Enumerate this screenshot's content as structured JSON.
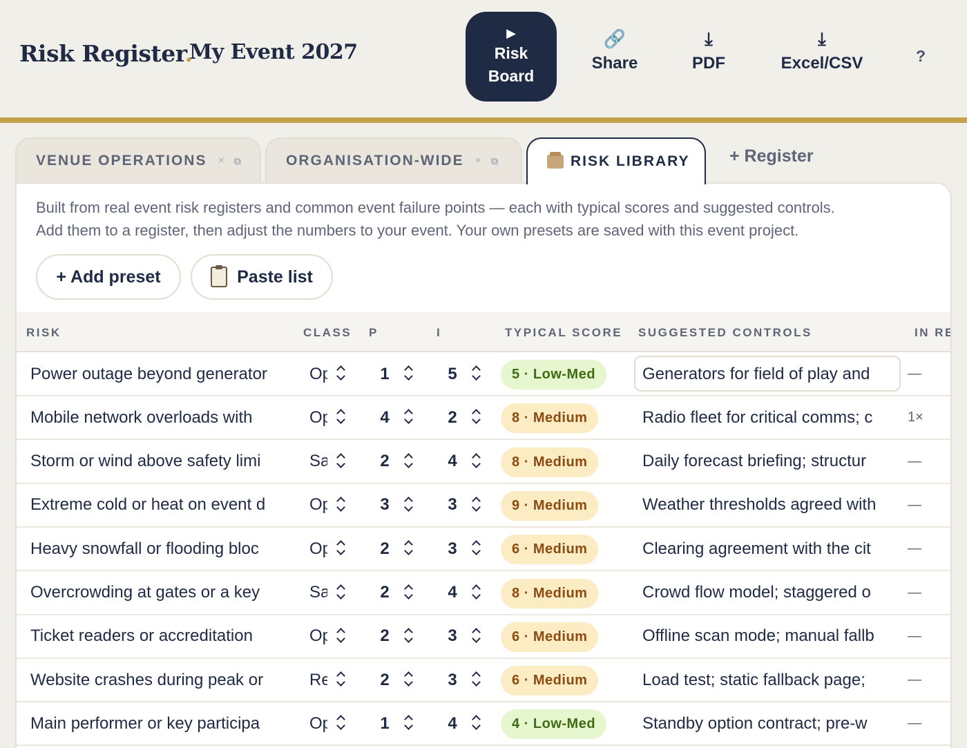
{
  "header": {
    "brand": "Risk Register",
    "brand_dot": ".",
    "event_name": "My Event 2027",
    "board_button": {
      "icon": "play-icon",
      "line1": "Risk",
      "line2": "Board"
    },
    "tools": [
      {
        "label": "Share",
        "icon": "link-icon"
      },
      {
        "label": "PDF",
        "icon": "download-icon"
      },
      {
        "label": "Excel/CSV",
        "icon": "download-icon"
      }
    ],
    "help": "?"
  },
  "tabs": [
    {
      "label": "VENUE OPERATIONS",
      "close": "×"
    },
    {
      "label": "ORGANISATION-WIDE",
      "close": "×"
    },
    {
      "label": "RISK LIBRARY"
    }
  ],
  "add_register": "+ Register",
  "library": {
    "intro_line1": "Built from real event risk registers and common event failure points — each with typical scores and suggested controls.",
    "intro_line2": "Add them to a register, then adjust the numbers to your event. Your own presets are saved with this event project.",
    "add_preset": "+ Add preset",
    "paste_list": "Paste list"
  },
  "table": {
    "columns": [
      "RISK",
      "CLASS",
      "P",
      "I",
      "TYPICAL SCORE",
      "SUGGESTED CONTROLS",
      "IN RE"
    ],
    "rows": [
      {
        "risk": "Power outage beyond generator",
        "cls": "Op",
        "p": "1",
        "i": "5",
        "score": "5 · Low-Med",
        "level": "lowmed",
        "controls": "Generators for field of play and",
        "in_reg": "—"
      },
      {
        "risk": "Mobile network overloads with",
        "cls": "Op",
        "p": "4",
        "i": "2",
        "score": "8 · Medium",
        "level": "medium",
        "controls": "Radio fleet for critical comms; c",
        "in_reg": "1×"
      },
      {
        "risk": "Storm or wind above safety limi",
        "cls": "Sa",
        "p": "2",
        "i": "4",
        "score": "8 · Medium",
        "level": "medium",
        "controls": "Daily forecast briefing; structur",
        "in_reg": "—"
      },
      {
        "risk": "Extreme cold or heat on event d",
        "cls": "Op",
        "p": "3",
        "i": "3",
        "score": "9 · Medium",
        "level": "medium",
        "controls": "Weather thresholds agreed with",
        "in_reg": "—"
      },
      {
        "risk": "Heavy snowfall or flooding bloc",
        "cls": "Op",
        "p": "2",
        "i": "3",
        "score": "6 · Medium",
        "level": "medium",
        "controls": "Clearing agreement with the cit",
        "in_reg": "—"
      },
      {
        "risk": "Overcrowding at gates or a key",
        "cls": "Sa",
        "p": "2",
        "i": "4",
        "score": "8 · Medium",
        "level": "medium",
        "controls": "Crowd flow model; staggered o",
        "in_reg": "—"
      },
      {
        "risk": "Ticket readers or accreditation",
        "cls": "Op",
        "p": "2",
        "i": "3",
        "score": "6 · Medium",
        "level": "medium",
        "controls": "Offline scan mode; manual fallb",
        "in_reg": "—"
      },
      {
        "risk": "Website crashes during peak or",
        "cls": "Re",
        "p": "2",
        "i": "3",
        "score": "6 · Medium",
        "level": "medium",
        "controls": "Load test; static fallback page;",
        "in_reg": "—"
      },
      {
        "risk": "Main performer or key participa",
        "cls": "Op",
        "p": "1",
        "i": "4",
        "score": "4 · Low-Med",
        "level": "lowmed",
        "controls": "Standby option contract; pre-w",
        "in_reg": "—"
      }
    ]
  },
  "colors": {
    "navy": "#1f2a44",
    "gold": "#c6a24e",
    "lowmed_bg": "#e6f7cf",
    "medium_bg": "#fcecc4"
  }
}
